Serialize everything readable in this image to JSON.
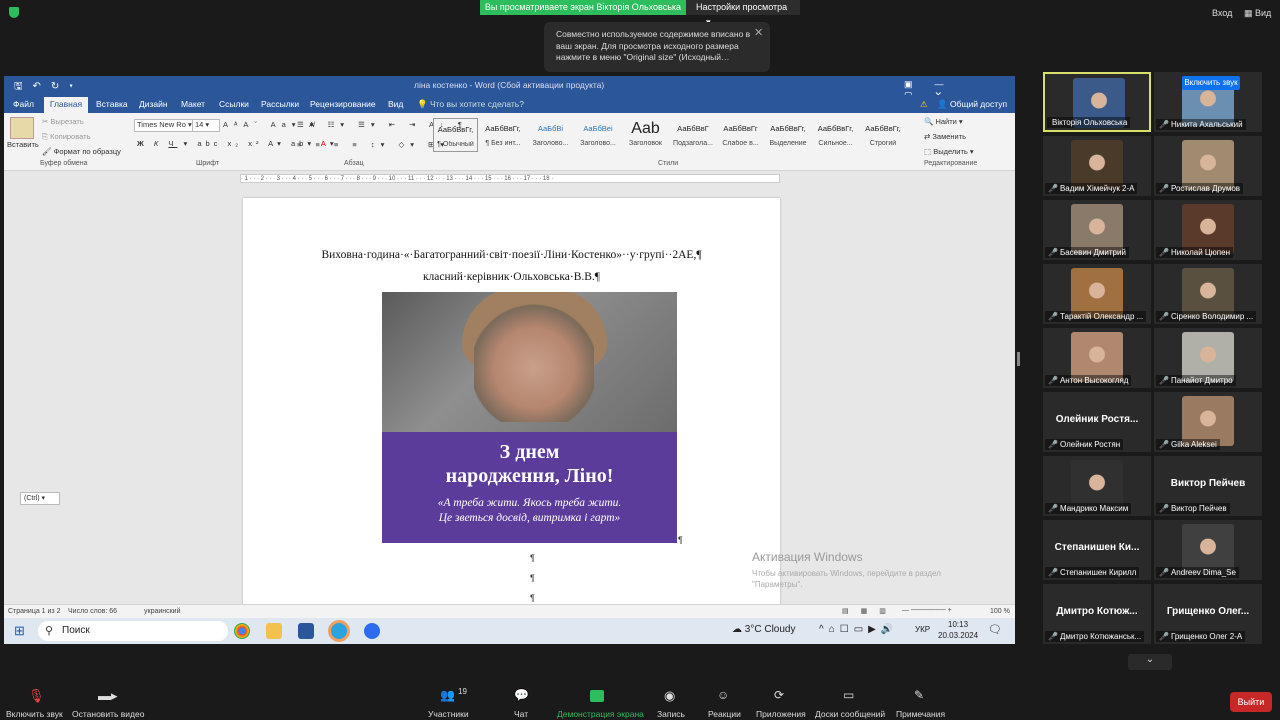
{
  "zoom": {
    "share_banner": "Вы просматриваете экран Вікторія Ольховська",
    "view_settings": "Настройки просмотра",
    "signin": "Вход",
    "view": "Вид",
    "tooltip": "Совместно используемое содержимое вписано в ваш экран. Для просмотра исходного размера нажмите в меню \"Original size\" (Исходный…",
    "bottom": {
      "mute": "Включить звук",
      "video": "Остановить видео",
      "participants": "Участники",
      "participants_count": "19",
      "chat": "Чат",
      "share": "Демонстрация экрана",
      "record": "Запись",
      "reactions": "Реакции",
      "apps": "Приложения",
      "whiteboards": "Доски сообщений",
      "notes": "Примечания",
      "leave": "Выйти"
    },
    "unmute_pill": "Включить звук"
  },
  "word": {
    "title": "ліна костенко - Word (Сбой активации продукта)",
    "tabs": [
      "Файл",
      "Главная",
      "Вставка",
      "Дизайн",
      "Макет",
      "Ссылки",
      "Рассылки",
      "Рецензирование",
      "Вид"
    ],
    "tell_me": "Что вы хотите сделать?",
    "share": "Общий доступ",
    "clipboard": {
      "paste": "Вставить",
      "cut": "Вырезать",
      "copy": "Копировать",
      "format": "Формат по образцу",
      "label": "Буфер обмена"
    },
    "font": {
      "name": "Times New Ro",
      "size": "14",
      "label": "Шрифт"
    },
    "paragraph_label": "Абзац",
    "styles_label": "Стили",
    "styles": [
      {
        "preview": "АаБбВвГг,",
        "name": "¶ Обычный"
      },
      {
        "preview": "АаБбВвГг,",
        "name": "¶ Без инт..."
      },
      {
        "preview": "АаБбВі",
        "name": "Заголово..."
      },
      {
        "preview": "АаБбВеі",
        "name": "Заголово..."
      },
      {
        "preview": "Aab",
        "name": "Заголовок"
      },
      {
        "preview": "АаБбВвГ",
        "name": "Подзагола..."
      },
      {
        "preview": "АаБбВвГг",
        "name": "Слабое в..."
      },
      {
        "preview": "АаБбВвГг,",
        "name": "Выделение"
      },
      {
        "preview": "АаБбВвГг,",
        "name": "Сильное..."
      },
      {
        "preview": "АаБбВвГг,",
        "name": "Строгий"
      }
    ],
    "editing": {
      "find": "Найти",
      "replace": "Заменить",
      "select": "Выделить",
      "label": "Редактирование"
    },
    "doc": {
      "line1": "Виховна·година·«·Багатогранний·світ·поезії·Ліни·Костенко»··у·групі··2АЕ,¶",
      "line2": "класний·керівник·Ольховська·В.В.¶",
      "photo_title": "З днем\nнародження, Ліно!",
      "photo_quote": "«А треба жити. Якось треба жити.\nЦе зветься досвід, витримка і гарт»",
      "pilcrow": "¶"
    },
    "ctrl_tag": "(Ctrl) ▾",
    "activate_title": "Активация Windows",
    "activate_sub": "Чтобы активировать Windows, перейдите в раздел \"Параметры\".",
    "status": {
      "page": "Страница 1 из 2",
      "words": "Число слов: 66",
      "lang": "украинский",
      "zoom": "100 %"
    }
  },
  "taskbar": {
    "search": "Поиск",
    "weather": "3°C  Cloudy",
    "lang": "УКР",
    "time": "10:13",
    "date": "20.03.2024"
  },
  "participants": [
    {
      "name": "Вікторія Ольховська",
      "color": "#3b5a8a"
    },
    {
      "name": "Никита Ахальський",
      "color": "#6a8fb0"
    },
    {
      "name": "Вадим Хімейчук 2-А",
      "color": "#4a3a2a"
    },
    {
      "name": "Ростислав Друмов",
      "color": "#a08a70"
    },
    {
      "name": "Басевин Дмитрий",
      "color": "#8a7a6a"
    },
    {
      "name": "Николай Цюпен",
      "color": "#5a3a2a"
    },
    {
      "name": "Тарактій Олександр ...",
      "color": "#a07040"
    },
    {
      "name": "Сіренко Володимир ...",
      "color": "#5a5040"
    },
    {
      "name": "Антон Высокогляд",
      "color": "#b08870"
    },
    {
      "name": "Панайот Дмитро",
      "color": "#b0b0a8"
    },
    {
      "name": "Олейник Ростя...",
      "sub": "Олейник Ростян",
      "big": true
    },
    {
      "name": "Gilka Aleksei",
      "color": "#9a7a60"
    },
    {
      "name": "Мандрико Максим",
      "color": "#303030"
    },
    {
      "name": "Виктор Пейчев",
      "sub": "Виктор Пейчев",
      "big": true
    },
    {
      "name": "Степанишен Ки...",
      "sub": "Степанишен Кирилл",
      "big": true
    },
    {
      "name": "Andreev Dima_Se",
      "color": "#404040"
    },
    {
      "name": "Дмитро Котюж...",
      "sub": "Дмитро Котюжанськ...",
      "big": true
    },
    {
      "name": "Грищенко Олег...",
      "sub": "Грищенко Олег 2-А",
      "big": true
    }
  ]
}
